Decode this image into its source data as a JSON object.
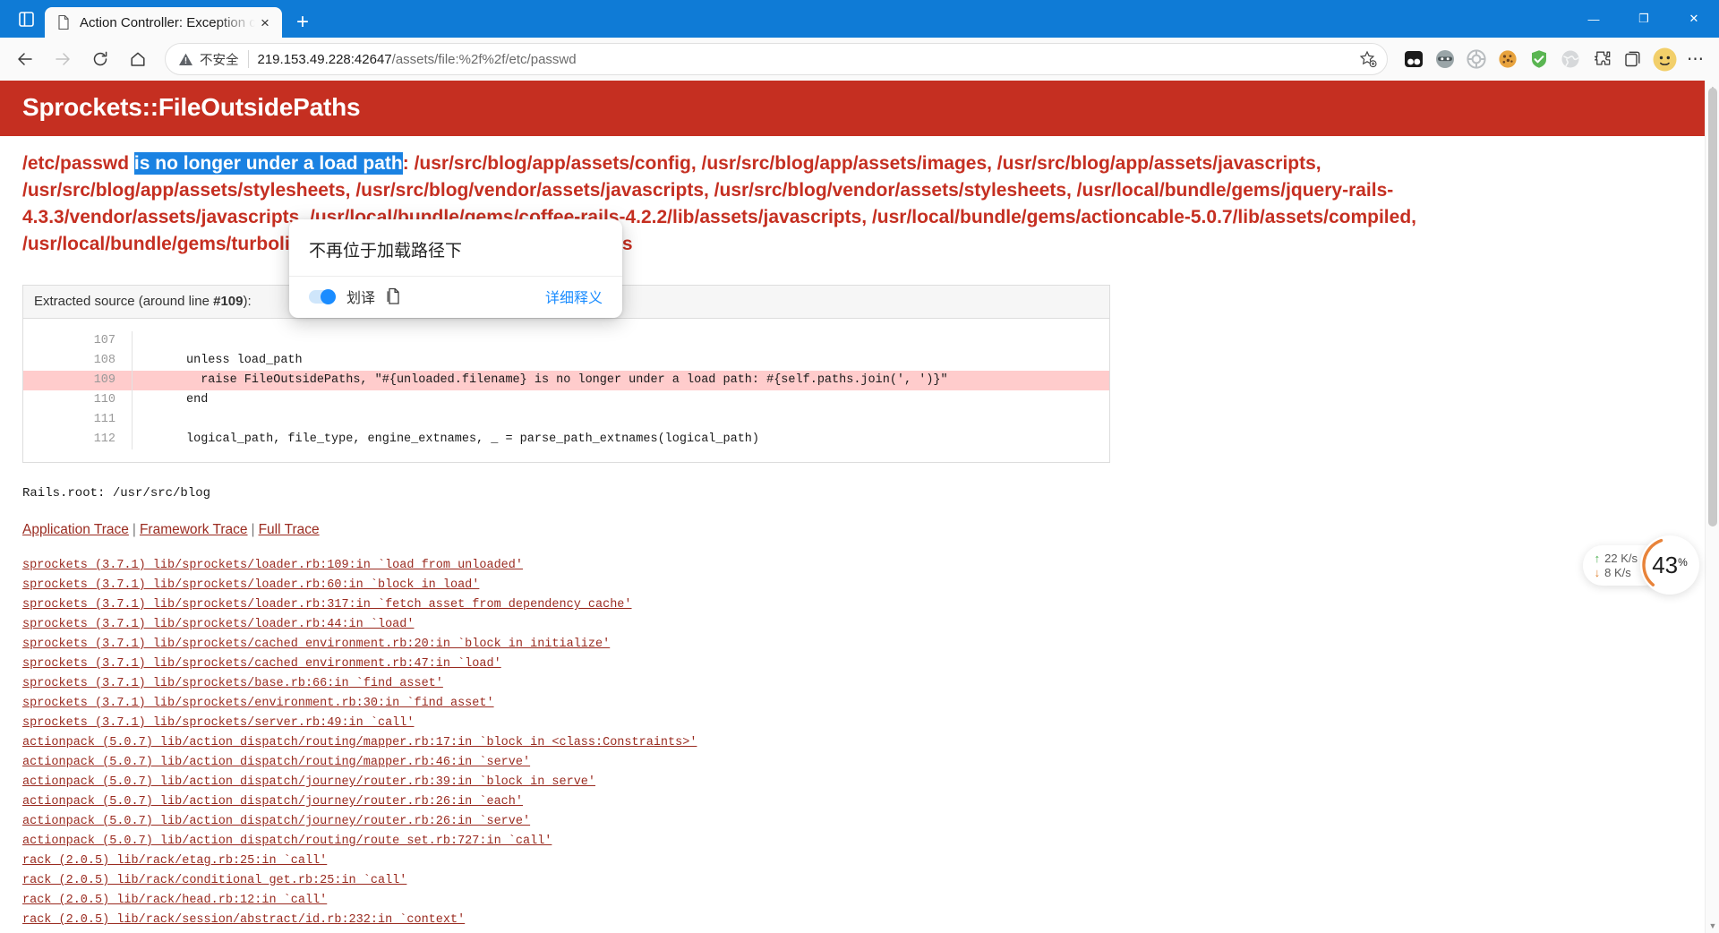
{
  "window": {
    "tab": {
      "title": "Action Controller: Exception caught",
      "favicon": "document-icon",
      "close": "×"
    },
    "newtab_label": "+",
    "controls": {
      "minimize": "—",
      "maximize": "❐",
      "close": "✕"
    }
  },
  "nav": {
    "back": "back-arrow",
    "forward": "forward-arrow",
    "reload": "reload-icon",
    "home": "home-icon",
    "security_label": "不安全",
    "url_host": "219.153.49.228:42647",
    "url_path": "/assets/file:%2f%2f/etc/passwd",
    "star": "add-favorite-icon",
    "extensions": [
      "split-screen-icon",
      "ninja-icon",
      "wheel-icon",
      "cookie-icon",
      "adguard-icon",
      "globe-icon",
      "puzzle-icon",
      "collections-icon",
      "profile-icon"
    ],
    "more": "⋯"
  },
  "page": {
    "heading": "Sprockets::FileOutsidePaths",
    "message_prefix": "/etc/passwd ",
    "message_selected": "is no longer under a load path",
    "message_suffix": ": /usr/src/blog/app/assets/config, /usr/src/blog/app/assets/images, /usr/src/blog/app/assets/javascripts, /usr/src/blog/app/assets/stylesheets, /usr/src/blog/vendor/assets/javascripts, /usr/src/blog/vendor/assets/stylesheets, /usr/local/bundle/gems/jquery-rails-4.3.3/vendor/assets/javascripts, /usr/local/bundle/gems/coffee-rails-4.2.2/lib/assets/javascripts, /usr/local/bundle/gems/actioncable-5.0.7/lib/assets/compiled, /usr/local/bundle/gems/turbolinks-source-5.2.0/lib/assets/javascripts",
    "source": {
      "header_prefix": "Extracted source (around line ",
      "header_line": "#109",
      "header_suffix": "):",
      "lines": [
        {
          "num": "107",
          "code": "",
          "highlight": false
        },
        {
          "num": "108",
          "code": "unless load_path",
          "highlight": false
        },
        {
          "num": "109",
          "code": "  raise FileOutsidePaths, \"#{unloaded.filename} is no longer under a load path: #{self.paths.join(', ')}\"",
          "highlight": true
        },
        {
          "num": "110",
          "code": "end",
          "highlight": false
        },
        {
          "num": "111",
          "code": "",
          "highlight": false
        },
        {
          "num": "112",
          "code": "logical_path, file_type, engine_extnames, _ = parse_path_extnames(logical_path)",
          "highlight": false
        }
      ]
    },
    "rails_root": "Rails.root: /usr/src/blog",
    "trace_nav": [
      "Application Trace",
      "Framework Trace",
      "Full Trace"
    ],
    "trace_separator": "|",
    "trace_lines": [
      "sprockets (3.7.1) lib/sprockets/loader.rb:109:in `load_from_unloaded'",
      "sprockets (3.7.1) lib/sprockets/loader.rb:60:in `block in load'",
      "sprockets (3.7.1) lib/sprockets/loader.rb:317:in `fetch_asset_from_dependency_cache'",
      "sprockets (3.7.1) lib/sprockets/loader.rb:44:in `load'",
      "sprockets (3.7.1) lib/sprockets/cached_environment.rb:20:in `block in initialize'",
      "sprockets (3.7.1) lib/sprockets/cached_environment.rb:47:in `load'",
      "sprockets (3.7.1) lib/sprockets/base.rb:66:in `find_asset'",
      "sprockets (3.7.1) lib/sprockets/environment.rb:30:in `find_asset'",
      "sprockets (3.7.1) lib/sprockets/server.rb:49:in `call'",
      "actionpack (5.0.7) lib/action_dispatch/routing/mapper.rb:17:in `block in <class:Constraints>'",
      "actionpack (5.0.7) lib/action_dispatch/routing/mapper.rb:46:in `serve'",
      "actionpack (5.0.7) lib/action_dispatch/journey/router.rb:39:in `block in serve'",
      "actionpack (5.0.7) lib/action_dispatch/journey/router.rb:26:in `each'",
      "actionpack (5.0.7) lib/action_dispatch/journey/router.rb:26:in `serve'",
      "actionpack (5.0.7) lib/action_dispatch/routing/route_set.rb:727:in `call'",
      "rack (2.0.5) lib/rack/etag.rb:25:in `call'",
      "rack (2.0.5) lib/rack/conditional_get.rb:25:in `call'",
      "rack (2.0.5) lib/rack/head.rb:12:in `call'",
      "rack (2.0.5) lib/rack/session/abstract/id.rb:232:in `context'"
    ]
  },
  "translate_popup": {
    "text": "不再位于加载路径下",
    "toggle_label": "划译",
    "copy_icon": "copy-icon",
    "detail_link": "详细释义"
  },
  "net_widget": {
    "upload": "22  K/s",
    "download": "8  K/s",
    "up_arrow": "↑",
    "down_arrow": "↓",
    "percent_value": "43",
    "percent_unit": "%",
    "arc_color": "#e8833a"
  },
  "colors": {
    "error_red": "#c52f21",
    "selection_blue": "#1a82e2",
    "link_red": "#9a2b20",
    "accent_blue": "#1a8cff",
    "chrome_blue": "#0f7bd6"
  }
}
